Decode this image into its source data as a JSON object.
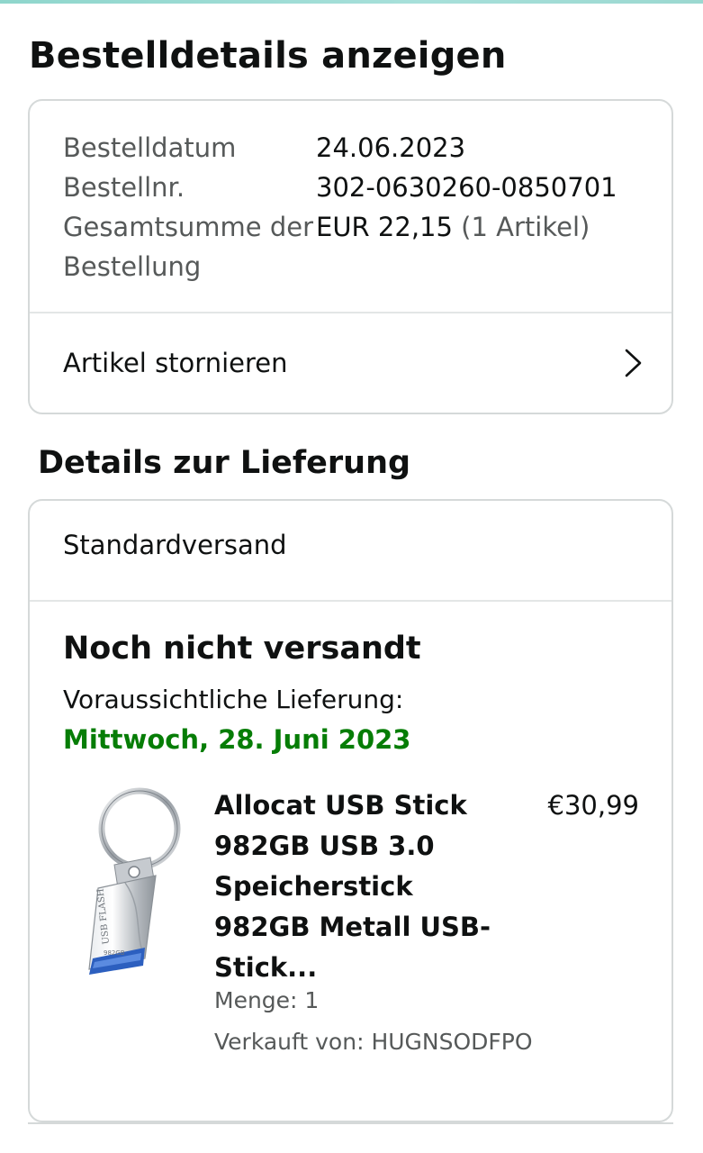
{
  "page": {
    "title": "Bestelldetails anzeigen"
  },
  "order": {
    "rows": [
      {
        "label": "Bestelldatum",
        "value": "24.06.2023"
      },
      {
        "label": "Bestellnr.",
        "value": "302-0630260-0850701"
      },
      {
        "label": "Gesamtsumme der Bestellung",
        "value": "EUR 22,15",
        "suffix": "(1 Artikel)"
      }
    ],
    "cancel_label": "Artikel stornieren"
  },
  "delivery": {
    "section_title": "Details zur Lieferung",
    "shipping_method": "Standardversand",
    "status": "Noch nicht versandt",
    "eta_label": "Voraussichtliche Lieferung:",
    "eta_date": "Mittwoch, 28. Juni 2023",
    "eta_color": "#067d06"
  },
  "product": {
    "title": "Allocat USB Stick 982GB USB 3.0 Speicherstick 982GB Metall USB-Stick...",
    "price": "€30,99",
    "quantity": "Menge: 1",
    "seller": "Verkauft von: HUGNSODFPO",
    "image_icon": "usb-flash-drive-image",
    "image_text": "USB FLASH 982GB"
  },
  "icons": {
    "cancel_chevron": "chevron-right-icon"
  }
}
